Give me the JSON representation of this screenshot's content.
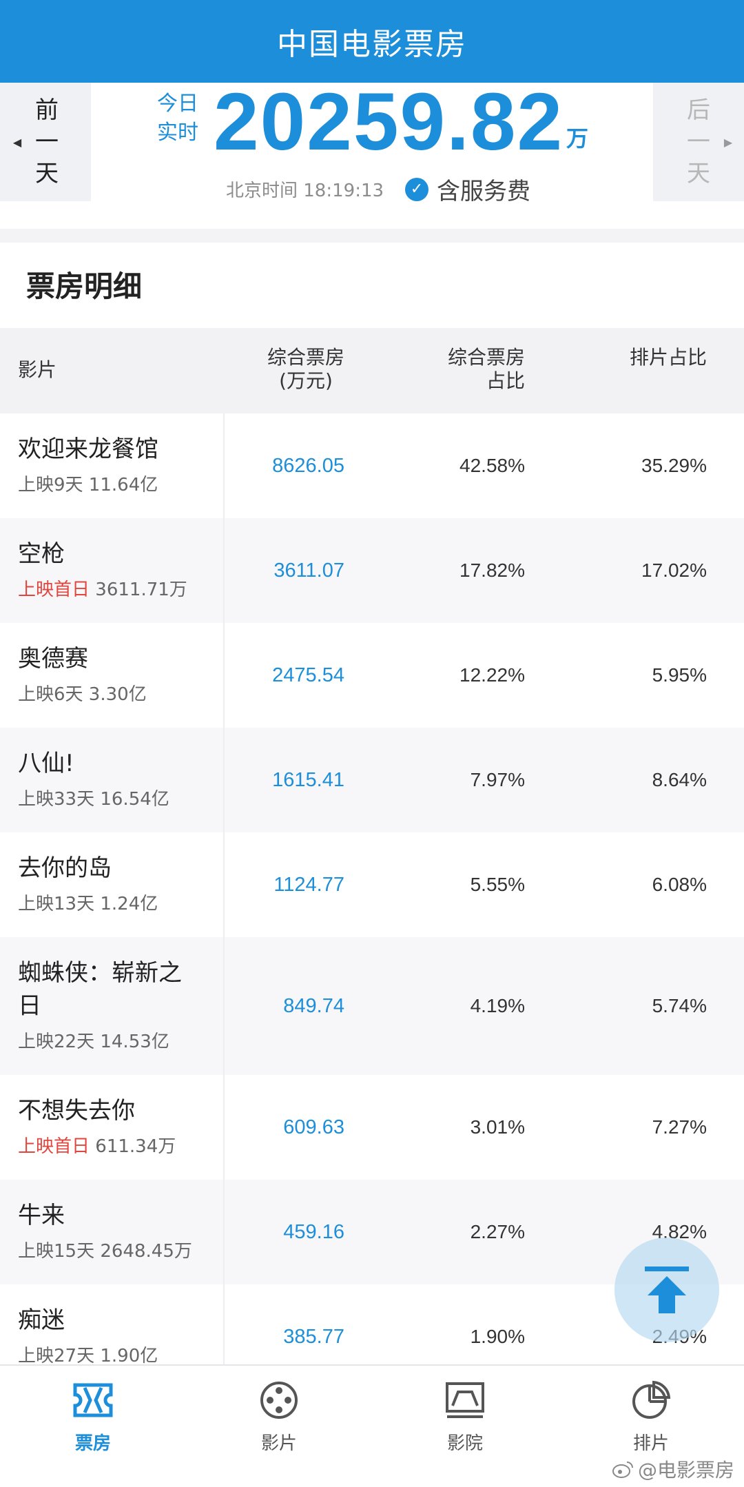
{
  "header": {
    "title": "中国电影票房"
  },
  "summary": {
    "prev_day": [
      "前",
      "一",
      "天"
    ],
    "next_day": [
      "后",
      "一",
      "天"
    ],
    "today_label": [
      "今日",
      "实时"
    ],
    "total": "20259.82",
    "unit": "万",
    "time": "北京时间 18:19:13",
    "service_fee_label": "含服务费"
  },
  "detail": {
    "title": "票房明细",
    "columns": {
      "film": "影片",
      "box_line1": "综合票房",
      "box_line2": "(万元)",
      "share_line1": "综合票房",
      "share_line2": "占比",
      "sched": "排片占比"
    },
    "rows": [
      {
        "name": "欢迎来龙餐馆",
        "meta_plain": "上映9天 11.64亿",
        "meta_red": "",
        "box": "8626.05",
        "share": "42.58%",
        "sched": "35.29%"
      },
      {
        "name": "空枪",
        "meta_red": "上映首日",
        "meta_plain": " 3611.71万",
        "box": "3611.07",
        "share": "17.82%",
        "sched": "17.02%"
      },
      {
        "name": "奥德赛",
        "meta_plain": "上映6天 3.30亿",
        "meta_red": "",
        "box": "2475.54",
        "share": "12.22%",
        "sched": "5.95%"
      },
      {
        "name": "八仙!",
        "meta_plain": "上映33天 16.54亿",
        "meta_red": "",
        "box": "1615.41",
        "share": "7.97%",
        "sched": "8.64%"
      },
      {
        "name": "去你的岛",
        "meta_plain": "上映13天 1.24亿",
        "meta_red": "",
        "box": "1124.77",
        "share": "5.55%",
        "sched": "6.08%"
      },
      {
        "name": "蜘蛛侠：崭新之日",
        "meta_plain": "上映22天 14.53亿",
        "meta_red": "",
        "box": "849.74",
        "share": "4.19%",
        "sched": "5.74%"
      },
      {
        "name": "不想失去你",
        "meta_red": "上映首日",
        "meta_plain": " 611.34万",
        "box": "609.63",
        "share": "3.01%",
        "sched": "7.27%"
      },
      {
        "name": "牛来",
        "meta_plain": "上映15天 2648.45万",
        "meta_red": "",
        "box": "459.16",
        "share": "2.27%",
        "sched": "4.82%"
      },
      {
        "name": "痴迷",
        "meta_plain": "上映27天 1.90亿",
        "meta_red": "",
        "box": "385.77",
        "share": "1.90%",
        "sched": "2.49%"
      }
    ]
  },
  "nav": {
    "items": [
      {
        "label": "票房",
        "icon": "ticket-icon"
      },
      {
        "label": "影片",
        "icon": "film-reel-icon"
      },
      {
        "label": "影院",
        "icon": "cinema-screen-icon"
      },
      {
        "label": "排片",
        "icon": "pie-chart-icon"
      }
    ]
  },
  "watermark": "@电影票房",
  "colors": {
    "brand": "#1d8ed9",
    "red": "#e0463e"
  }
}
